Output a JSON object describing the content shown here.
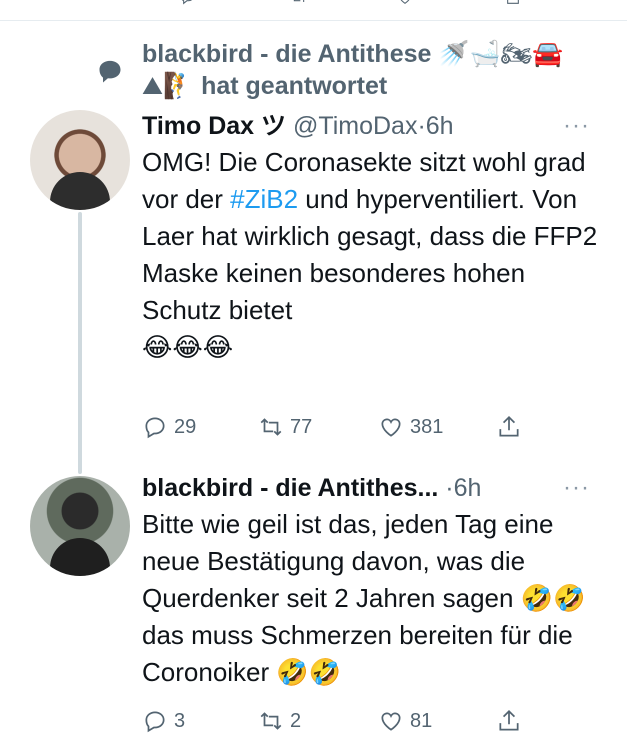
{
  "reply_banner": {
    "text": "blackbird - die Antithese",
    "emojis": "🚿🛁🏍🚘",
    "emojis2": "⛰🧗",
    "action": "hat geantwortet"
  },
  "tweet1": {
    "name": "Timo Dax ツ",
    "handle": "@TimoDax·6h",
    "more": "···",
    "text_before_link": "OMG! Die Coronasekte sitzt wohl grad vor der ",
    "link": "#ZiB2",
    "text_after_link": " und hyperventiliert. Von Laer hat wirklich gesagt, dass die FFP2 Maske keinen besonderes hohen Schutz bietet",
    "emoji_line": "😂😂😂",
    "reply_count": "29",
    "retweet_count": "77",
    "like_count": "381"
  },
  "tweet2": {
    "name": "blackbird - die Antithes...",
    "handle": "·6h",
    "more": "···",
    "text": "Bitte wie geil ist das, jeden Tag eine neue Bestätigung davon, was die Querdenker seit 2 Jahren sagen 🤣🤣 das muss Schmerzen bereiten für die Coronoiker 🤣🤣",
    "reply_count": "3",
    "retweet_count": "2",
    "like_count": "81"
  }
}
